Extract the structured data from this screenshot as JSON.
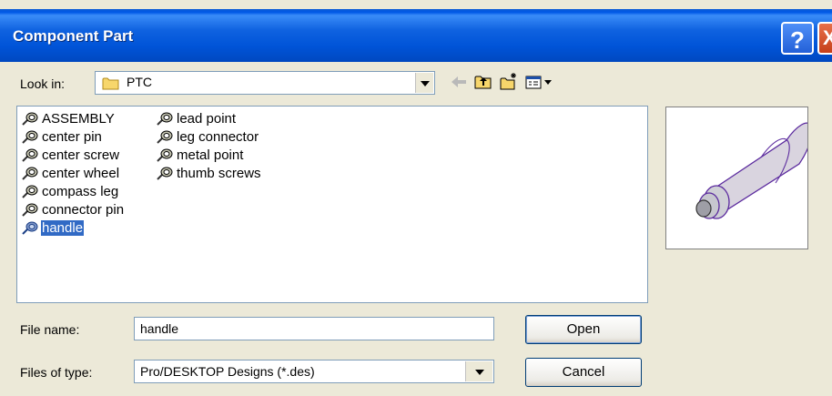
{
  "window": {
    "title": "Component Part",
    "help_label": "?",
    "close_label": "X"
  },
  "lookin": {
    "label": "Look in:",
    "value": "PTC"
  },
  "toolbar": {
    "icons": [
      "back-arrow-icon",
      "up-folder-icon",
      "new-folder-icon",
      "view-menu-icon"
    ]
  },
  "files": {
    "column1": [
      {
        "name": "ASSEMBLY",
        "selected": false
      },
      {
        "name": "center pin",
        "selected": false
      },
      {
        "name": "center screw",
        "selected": false
      },
      {
        "name": "center wheel",
        "selected": false
      },
      {
        "name": "compass leg",
        "selected": false
      },
      {
        "name": "connector pin",
        "selected": false
      },
      {
        "name": "handle",
        "selected": true
      }
    ],
    "column2": [
      {
        "name": "lead point",
        "selected": false
      },
      {
        "name": "leg connector",
        "selected": false
      },
      {
        "name": "metal point",
        "selected": false
      },
      {
        "name": "thumb screws",
        "selected": false
      }
    ]
  },
  "filename": {
    "label": "File name:",
    "value": "handle"
  },
  "filetype": {
    "label": "Files of type:",
    "value": "Pro/DESKTOP Designs (*.des)"
  },
  "buttons": {
    "open": "Open",
    "cancel": "Cancel"
  },
  "colors": {
    "title_bar": "#0054e3",
    "selection": "#316ac5",
    "dialog_bg": "#ece9d8",
    "preview_outline": "#6b2fb8"
  }
}
